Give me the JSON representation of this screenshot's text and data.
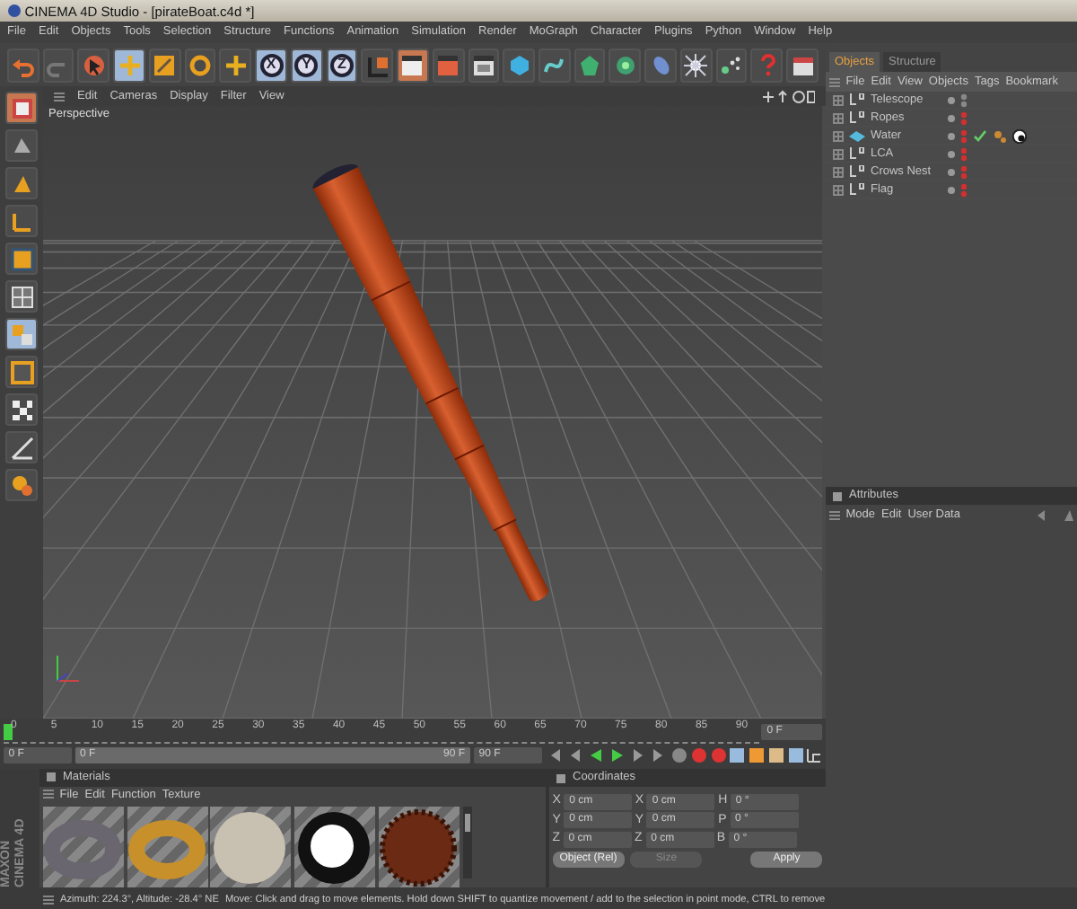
{
  "window": {
    "title": "CINEMA 4D Studio - [pirateBoat.c4d *]"
  },
  "menu": [
    "File",
    "Edit",
    "Objects",
    "Tools",
    "Selection",
    "Structure",
    "Functions",
    "Animation",
    "Simulation",
    "Render",
    "MoGraph",
    "Character",
    "Plugins",
    "Python",
    "Window",
    "Help"
  ],
  "toolbar": {
    "axis_buttons": [
      {
        "label": "X",
        "on": true
      },
      {
        "label": "Y",
        "on": true
      },
      {
        "label": "Z",
        "on": true
      }
    ]
  },
  "viewport": {
    "menu": [
      "Edit",
      "Cameras",
      "Display",
      "Filter",
      "View"
    ],
    "label": "Perspective"
  },
  "object_manager": {
    "tabs": [
      {
        "label": "Objects",
        "selected": true
      },
      {
        "label": "Structure",
        "selected": false
      }
    ],
    "menu": [
      "File",
      "Edit",
      "View",
      "Objects",
      "Tags",
      "Bookmark"
    ],
    "objects": [
      {
        "name": "Telescope",
        "kind": "null",
        "hidden": false
      },
      {
        "name": "Ropes",
        "kind": "null",
        "hidden": true
      },
      {
        "name": "Water",
        "kind": "plane",
        "hidden": true,
        "tags": [
          {
            "kind": "check"
          },
          {
            "kind": "texture"
          },
          {
            "kind": "material"
          }
        ]
      },
      {
        "name": "LCA",
        "kind": "null",
        "hidden": true
      },
      {
        "name": "Crows Nest",
        "kind": "null",
        "hidden": true
      },
      {
        "name": "Flag",
        "kind": "null",
        "hidden": true
      }
    ]
  },
  "attributes": {
    "title": "Attributes",
    "menu": [
      "Mode",
      "Edit",
      "User Data"
    ]
  },
  "timeline": {
    "ticks": [
      "0",
      "5",
      "10",
      "15",
      "20",
      "25",
      "30",
      "35",
      "40",
      "45",
      "50",
      "55",
      "60",
      "65",
      "70",
      "75",
      "80",
      "85",
      "90"
    ],
    "level": 0,
    "current_frame": "0 F",
    "start": "0 F",
    "range": {
      "start": "0 F",
      "end": "90 F",
      "level": 1
    },
    "end": "90 F"
  },
  "materials": {
    "title": "Materials",
    "menu": [
      "File",
      "Edit",
      "Function",
      "Texture"
    ],
    "swatches": [
      {
        "kind": "torus",
        "color": "#6a6670"
      },
      {
        "kind": "torus",
        "color": "#c8902a"
      },
      {
        "kind": "sphere",
        "color": "#c8c0b0"
      },
      {
        "kind": "chrome",
        "color": "#ffffff"
      },
      {
        "kind": "fur",
        "color": "#6a2a14"
      }
    ]
  },
  "coordinates": {
    "title": "Coordinates",
    "rows": [
      {
        "position_label": "X",
        "position": "0 cm",
        "size_label": "X",
        "size": "0 cm",
        "rotation_label": "H",
        "rotation": "0 °"
      },
      {
        "position_label": "Y",
        "position": "0 cm",
        "size_label": "Y",
        "size": "0 cm",
        "rotation_label": "P",
        "rotation": "0 °"
      },
      {
        "position_label": "Z",
        "position": "0 cm",
        "size_label": "Z",
        "size": "0 cm",
        "rotation_label": "B",
        "rotation": "0 °"
      }
    ],
    "mode": "Object (Rel)",
    "size_mode": {
      "label": "Size",
      "disabled": true
    },
    "apply": "Apply"
  },
  "status_bar": {
    "position": "Azimuth: 224.3°, Altitude: -28.4°  NE",
    "message": "Move: Click and drag to move elements. Hold down SHIFT to quantize movement / add to the selection in point mode, CTRL to remove"
  },
  "logo": [
    "MAXON",
    "CINEMA 4D"
  ]
}
